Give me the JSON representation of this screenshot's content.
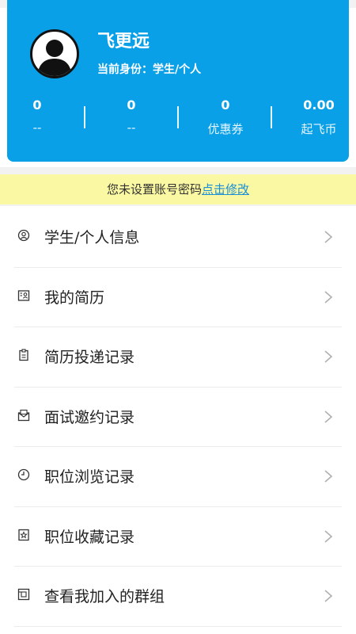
{
  "profile": {
    "name": "飞更远",
    "identity": "当前身份：学生/个人",
    "stats": [
      {
        "value": "0",
        "label": "--"
      },
      {
        "value": "0",
        "label": "--"
      },
      {
        "value": "0",
        "label": "优惠券"
      },
      {
        "value": "0.00",
        "label": "起飞币"
      }
    ]
  },
  "notice": {
    "text": "您未设置账号密码",
    "link": "点击修改"
  },
  "menu": [
    {
      "label": "学生/个人信息",
      "icon": "user-info-icon"
    },
    {
      "label": "我的简历",
      "icon": "resume-icon"
    },
    {
      "label": "简历投递记录",
      "icon": "resume-delivery-icon"
    },
    {
      "label": "面试邀约记录",
      "icon": "interview-invite-icon"
    },
    {
      "label": "职位浏览记录",
      "icon": "clock-icon"
    },
    {
      "label": "职位收藏记录",
      "icon": "favorite-icon"
    },
    {
      "label": "查看我加入的群组",
      "icon": "group-icon"
    }
  ],
  "colors": {
    "brand": "#0aa0e8",
    "notice_bg": "#fbf8a3",
    "link": "#1a8fd8"
  }
}
